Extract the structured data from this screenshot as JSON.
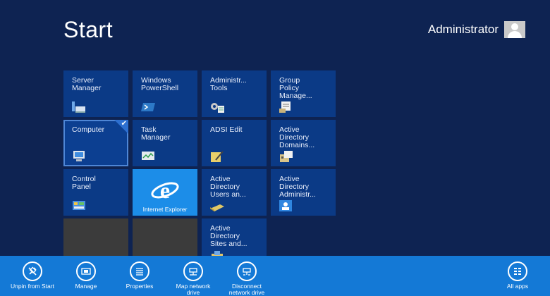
{
  "start": {
    "title": "Start"
  },
  "user": {
    "name": "Administrator"
  },
  "tiles": [
    {
      "label": "Server\nManager",
      "icon": "server-manager-icon"
    },
    {
      "label": "Windows\nPowerShell",
      "icon": "powershell-icon"
    },
    {
      "label": "Administr...\nTools",
      "icon": "admin-tools-icon"
    },
    {
      "label": "Group\nPolicy\nManage...",
      "icon": "group-policy-icon"
    },
    {
      "label": "Computer",
      "icon": "computer-icon",
      "selected": true
    },
    {
      "label": "Task\nManager",
      "icon": "task-manager-icon"
    },
    {
      "label": "ADSI Edit",
      "icon": "adsi-edit-icon"
    },
    {
      "label": "Active\nDirectory\nDomains...",
      "icon": "ad-domains-icon"
    },
    {
      "label": "Control\nPanel",
      "icon": "control-panel-icon"
    },
    {
      "label": "Internet Explorer",
      "icon": "internet-explorer-icon"
    },
    {
      "label": "Active\nDirectory\nUsers an...",
      "icon": "ad-users-icon"
    },
    {
      "label": "Active\nDirectory\nAdministr...",
      "icon": "ad-admin-center-icon"
    },
    {
      "label": "Active\nDirectory\nSites and...",
      "icon": "ad-sites-icon"
    }
  ],
  "appbar": {
    "unpin": "Unpin from Start",
    "manage": "Manage",
    "properties": "Properties",
    "map_drive": "Map network\ndrive",
    "disconnect_drive": "Disconnect\nnetwork drive",
    "all_apps": "All apps"
  },
  "colors": {
    "background": "#0e2352",
    "tile": "#0b3a86",
    "ie_tile": "#1c8de8",
    "appbar": "#1479d6"
  }
}
